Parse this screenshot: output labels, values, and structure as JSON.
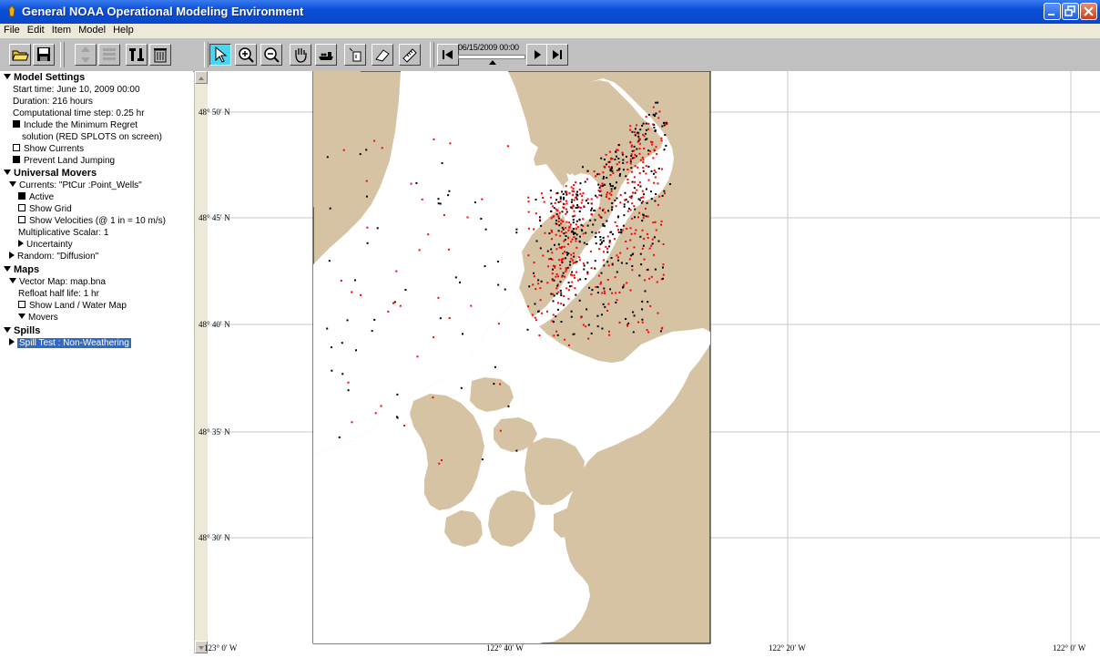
{
  "window": {
    "title": "General NOAA Operational Modeling Environment"
  },
  "menu": [
    "File",
    "Edit",
    "Item",
    "Model",
    "Help"
  ],
  "toolbar": {
    "time_display": "06/15/2009 00:00"
  },
  "sidebar": {
    "model_settings": {
      "header": "Model Settings",
      "start_time": "Start time: June 10, 2009 00:00",
      "duration": "Duration: 216 hours",
      "time_step": "Computational time step: 0.25 hr",
      "min_regret_1": "Include the Minimum Regret",
      "min_regret_2": "solution (RED SPLOTS on screen)",
      "show_currents": "Show Currents",
      "prevent_land_jumping": "Prevent Land Jumping"
    },
    "universal_movers": {
      "header": "Universal Movers",
      "currents": "Currents: \"PtCur :Point_Wells\"",
      "active": "Active",
      "show_grid": "Show Grid",
      "show_velocities": "Show Velocities (@ 1 in = 10 m/s)",
      "multiplicative_scalar": "Multiplicative Scalar: 1",
      "uncertainty": "Uncertainty",
      "random": "Random: \"Diffusion\""
    },
    "maps": {
      "header": "Maps",
      "vector_map": "Vector Map: map.bna",
      "refloat": "Refloat half life: 1 hr",
      "show_land_water": "Show Land / Water Map",
      "movers": "Movers"
    },
    "spills": {
      "header": "Spills",
      "spill_test": "Spill Test : Non-Weathering"
    }
  },
  "map": {
    "lat_labels": [
      "48° 50′ N",
      "48° 45′ N",
      "48° 40′ N",
      "48° 35′ N",
      "48° 30′ N"
    ],
    "lon_labels": [
      "123° 0′ W",
      "122° 40′ W",
      "122° 20′ W",
      "122° 0′ W"
    ],
    "colors": {
      "land": "#d6c3a4",
      "water": "#ffffff",
      "frame": "#000000",
      "gridline": "#c0c0c0",
      "best_guess_particles": "#000000",
      "minimum_regret_particles": "#ff0000"
    }
  }
}
